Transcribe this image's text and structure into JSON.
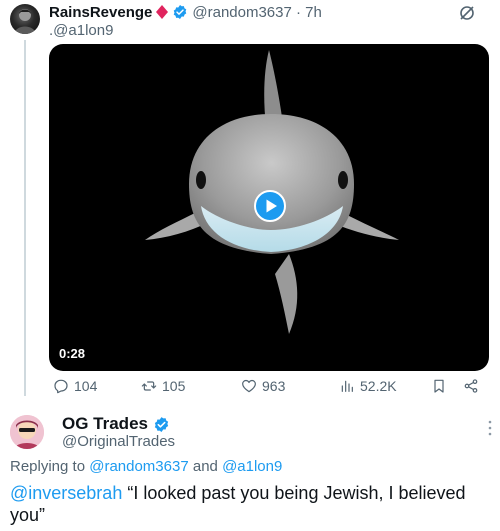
{
  "tweet1": {
    "display_name": "RainsRevenge",
    "handle_time": "@random3637 · 7h",
    "reply_handle": ".@a1lon9",
    "video_duration": "0:28",
    "stats": {
      "replies": "104",
      "retweets": "105",
      "likes": "963",
      "views": "52.2K"
    }
  },
  "tweet2": {
    "display_name": "OG Trades",
    "handle": "@OriginalTrades",
    "replying_prefix": "Replying to ",
    "replying_user1": "@random3637",
    "replying_and": " and ",
    "replying_user2": "@a1lon9",
    "mention": "@inversebrah",
    "body_text": " “I looked past you being Jewish, I believed you”"
  },
  "colors": {
    "accent": "#1d9bf0",
    "secondary_text": "#536471",
    "verified": "#1d9bf0",
    "diamond": "#e0245e"
  }
}
